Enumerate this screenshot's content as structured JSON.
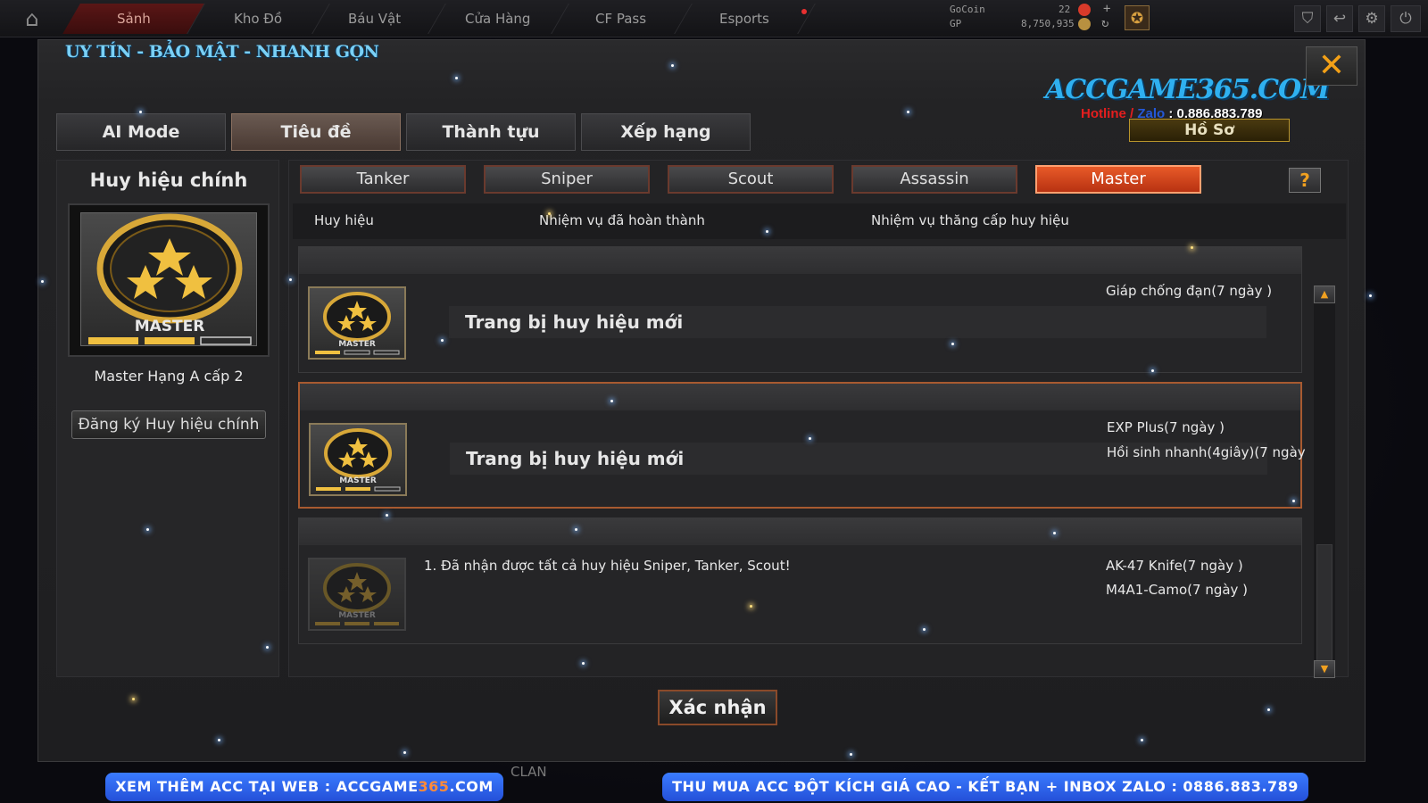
{
  "topbar": {
    "tabs": [
      "Sảnh",
      "Kho Đồ",
      "Báu Vật",
      "Cửa Hàng",
      "CF Pass",
      "Esports"
    ],
    "currency": {
      "gocoin_label": "GoCoin",
      "gp_label": "GP",
      "gocoin_value": "22",
      "gp_value": "8,750,935"
    }
  },
  "window": {
    "slogan": "UY TÍN - BẢO MẬT - NHANH GỌN",
    "brand": "ACCGAME365.COM",
    "hotline": {
      "label1": "Hotline",
      "sep": " / ",
      "label2": "Zalo",
      "number": " : 0.886.883.789"
    },
    "profile_button": "Hồ Sơ",
    "close_icon": "close-x-icon",
    "main_tabs": [
      "AI Mode",
      "Tiêu đề",
      "Thành tựu",
      "Xếp hạng"
    ],
    "active_main_tab": "Tiêu đề"
  },
  "left_panel": {
    "title": "Huy hiệu chính",
    "badge_text": "MASTER",
    "badge_progress": 0.67,
    "rank": "Master Hạng A cấp 2",
    "register_button": "Đăng ký Huy hiệu chính"
  },
  "right_panel": {
    "class_tabs": [
      "Tanker",
      "Sniper",
      "Scout",
      "Assassin",
      "Master"
    ],
    "active_class": "Master",
    "help": "?",
    "columns": [
      "Huy hiệu",
      "Nhiệm vụ đã hoàn thành",
      "Nhiệm vụ thăng cấp huy hiệu"
    ],
    "rows": [
      {
        "badge": "MASTER",
        "text": "Trang bị huy hiệu mới",
        "mission": "",
        "rewards": [
          "Giáp chống đạn(7 ngày )"
        ]
      },
      {
        "badge": "MASTER",
        "text": "Trang bị huy hiệu mới",
        "mission": "",
        "rewards": [
          "EXP Plus(7 ngày )",
          "Hồi sinh nhanh(4giây)(7 ngày"
        ]
      },
      {
        "badge": "MASTER",
        "text": "",
        "mission": "1. Đã nhận được tất cả huy hiệu Sniper, Tanker, Scout!",
        "rewards": [
          "AK-47 Knife(7 ngày )",
          "M4A1-Camo(7 ngày )"
        ]
      }
    ]
  },
  "confirm_button": "Xác nhận",
  "bottom": {
    "clan": "CLAN",
    "banner_left": {
      "prefix": "XEM THÊM ACC TẠI WEB : ACCGAME",
      "highlight": "365",
      "suffix": ".COM"
    },
    "banner_right": "THU MUA ACC ĐỘT KÍCH GIÁ CAO - KẾT BẠN + INBOX ZALO : 0886.883.789"
  },
  "colors": {
    "accent": "#e85a28",
    "brand": "#2fb0f0",
    "banner": "#2f66f0"
  }
}
